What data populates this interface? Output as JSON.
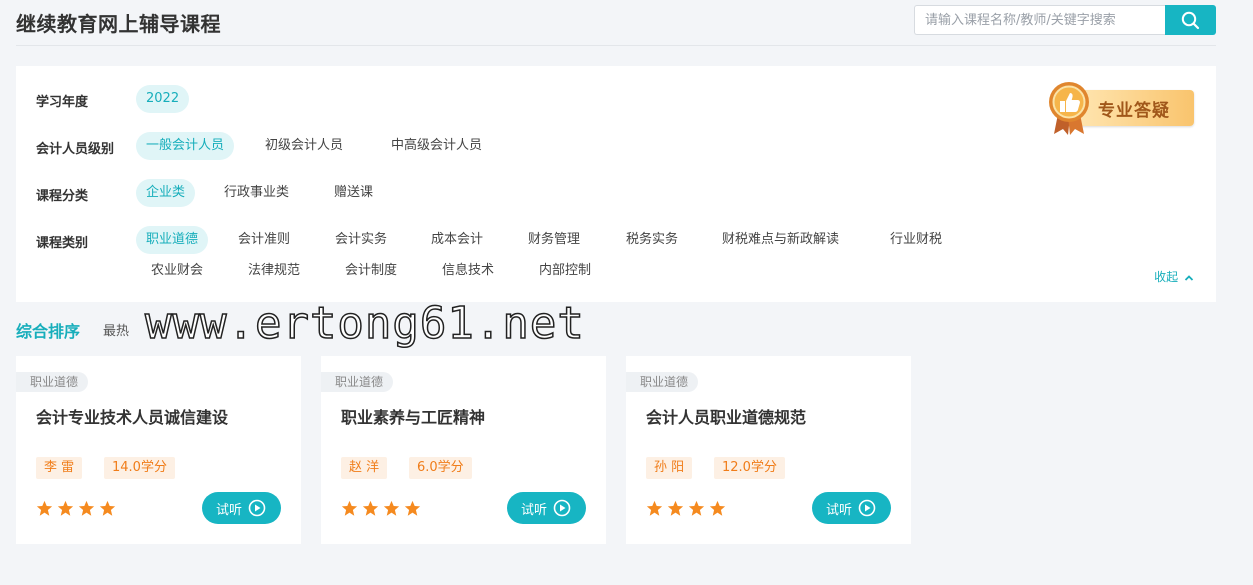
{
  "header": {
    "title": "继续教育网上辅导课程",
    "search": {
      "placeholder": "请输入课程名称/教师/关键字搜索",
      "value": ""
    },
    "search_icon": "search-icon"
  },
  "filters": {
    "year": {
      "label": "学习年度",
      "options": [
        "2022"
      ],
      "active": 0
    },
    "level": {
      "label": "会计人员级别",
      "options": [
        "一般会计人员",
        "初级会计人员",
        "中高级会计人员"
      ],
      "active": 0
    },
    "category": {
      "label": "课程分类",
      "options": [
        "企业类",
        "行政事业类",
        "赠送课"
      ],
      "active": 0
    },
    "type": {
      "label": "课程类别",
      "options": [
        "职业道德",
        "会计准则",
        "会计实务",
        "成本会计",
        "财务管理",
        "税务实务",
        "财税难点与新政解读",
        "行业财税",
        "农业财会",
        "法律规范",
        "会计制度",
        "信息技术",
        "内部控制"
      ],
      "active": 0
    },
    "collapse_label": "收起",
    "badge_label": "专业答疑"
  },
  "sort": {
    "main": "综合排序",
    "hot": "最热"
  },
  "watermark": "www.ertong61.net",
  "courses": [
    {
      "tag": "职业道德",
      "title": "会计专业技术人员诚信建设",
      "teacher": "李 雷",
      "credits": "14.0学分",
      "stars": 4,
      "button": "试听"
    },
    {
      "tag": "职业道德",
      "title": "职业素养与工匠精神",
      "teacher": "赵 洋",
      "credits": "6.0学分",
      "stars": 4,
      "button": "试听"
    },
    {
      "tag": "职业道德",
      "title": "会计人员职业道德规范",
      "teacher": "孙 阳",
      "credits": "12.0学分",
      "stars": 4,
      "button": "试听"
    }
  ],
  "colors": {
    "accent": "#17b5c3",
    "accent_text": "#17aebb",
    "credit": "#f07d1a",
    "star": "#f58a1f"
  }
}
